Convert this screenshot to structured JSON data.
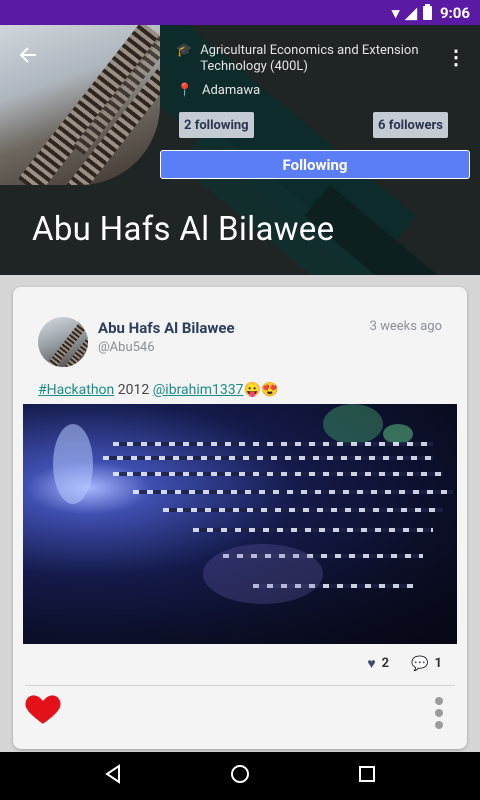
{
  "status_bar": {
    "time": "9:06"
  },
  "profile": {
    "education": "Agricultural Economics and Extension Technology (400L)",
    "location": "Adamawa",
    "following_label": "2 following",
    "followers_label": "6 followers",
    "follow_button_label": "Following",
    "name": "Abu Hafs Al Bilawee"
  },
  "post": {
    "author_name": "Abu Hafs Al Bilawee",
    "author_handle": "@Abu546",
    "timestamp": "3 weeks ago",
    "hashtag": "#Hackathon",
    "year": "2012",
    "mention": "@ibrahim1337",
    "emoji": "😛😍",
    "likes": "2",
    "comments": "1"
  },
  "colors": {
    "status_bar": "#5b1aa3",
    "follow_button": "#5b7df5",
    "heart": "#e3121a",
    "link": "#1a8d8a"
  }
}
